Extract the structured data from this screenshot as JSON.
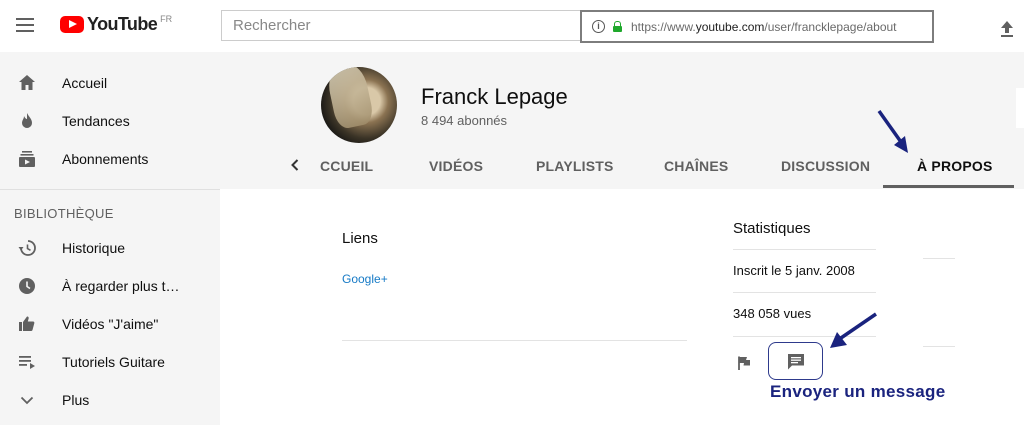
{
  "header": {
    "logo_text": "YouTube",
    "country_code": "FR",
    "search_placeholder": "Rechercher",
    "url_prefix": "https://www.",
    "url_domain": "youtube.com",
    "url_path": "/user/francklepage/about"
  },
  "sidebar": {
    "items": [
      {
        "label": "Accueil",
        "icon": "home-icon"
      },
      {
        "label": "Tendances",
        "icon": "flame-icon"
      },
      {
        "label": "Abonnements",
        "icon": "subscriptions-icon"
      }
    ],
    "library_header": "BIBLIOTHÈQUE",
    "library_items": [
      {
        "label": "Historique",
        "icon": "history-icon"
      },
      {
        "label": "À regarder plus t…",
        "icon": "clock-icon"
      },
      {
        "label": "Vidéos \"J'aime\"",
        "icon": "thumbs-up-icon"
      },
      {
        "label": "Tutoriels Guitare",
        "icon": "playlist-icon"
      },
      {
        "label": "Plus",
        "icon": "chevron-down-icon"
      }
    ]
  },
  "channel": {
    "name": "Franck Lepage",
    "subscribers": "8 494 abonnés",
    "tabs": [
      {
        "label": "CCUEIL",
        "active": false
      },
      {
        "label": "VIDÉOS",
        "active": false
      },
      {
        "label": "PLAYLISTS",
        "active": false
      },
      {
        "label": "CHAÎNES",
        "active": false
      },
      {
        "label": "DISCUSSION",
        "active": false
      },
      {
        "label": "À PROPOS",
        "active": true
      }
    ]
  },
  "about": {
    "links_title": "Liens",
    "links": [
      "Google+"
    ],
    "stats_title": "Statistiques",
    "joined": "Inscrit le 5 janv. 2008",
    "views": "348 058 vues"
  },
  "annotation": {
    "label": "Envoyer un message",
    "color": "#1a237e"
  }
}
